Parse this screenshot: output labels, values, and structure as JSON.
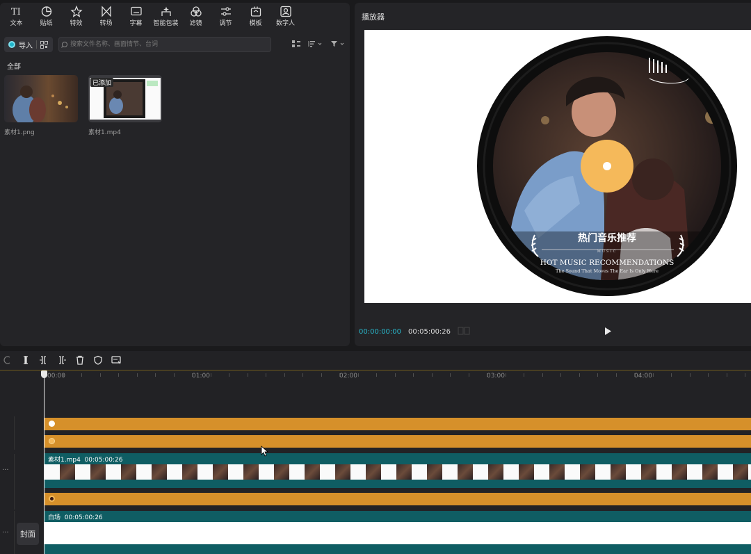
{
  "toolbar": {
    "tools": [
      {
        "label": "文本",
        "icon": "text-icon"
      },
      {
        "label": "贴纸",
        "icon": "sticker-icon"
      },
      {
        "label": "特效",
        "icon": "effects-icon"
      },
      {
        "label": "转场",
        "icon": "transition-icon"
      },
      {
        "label": "字幕",
        "icon": "subtitle-icon"
      },
      {
        "label": "智能包装",
        "icon": "smart-pack-icon"
      },
      {
        "label": "滤镜",
        "icon": "filter-icon"
      },
      {
        "label": "调节",
        "icon": "adjust-icon"
      },
      {
        "label": "模板",
        "icon": "template-icon"
      },
      {
        "label": "数字人",
        "icon": "digital-human-icon"
      }
    ]
  },
  "media": {
    "import_label": "导入",
    "search_placeholder": "搜索文件名称、画面情节、台词",
    "section_label": "全部",
    "items": [
      {
        "name": "素材1.png",
        "badge": ""
      },
      {
        "name": "素材1.mp4",
        "badge": "已添加"
      }
    ]
  },
  "player": {
    "title": "播放器",
    "current_time": "00:00:00:00",
    "total_time": "00:05:00:26",
    "canvas": {
      "title_cn": "热门音乐推荐",
      "music_label": "MUSIC",
      "title_en": "HOT MUSIC RECOMMENDATIONS",
      "subtitle_en": "The Sound That Moves The Ear Is Only Here",
      "record_color": "#111111",
      "label_color": "#f5b95a"
    }
  },
  "timeline": {
    "ruler_labels": [
      "00:00",
      "01:00",
      "02:00",
      "03:00",
      "04:00"
    ],
    "video_track": {
      "name": "素材1.mp4",
      "duration": "00:05:00:26"
    },
    "cover_track": {
      "name": "白场",
      "duration": "00:05:00:26"
    },
    "cover_button": "封面",
    "track_color": "#d6902a",
    "teal_color": "#0f5d63"
  }
}
